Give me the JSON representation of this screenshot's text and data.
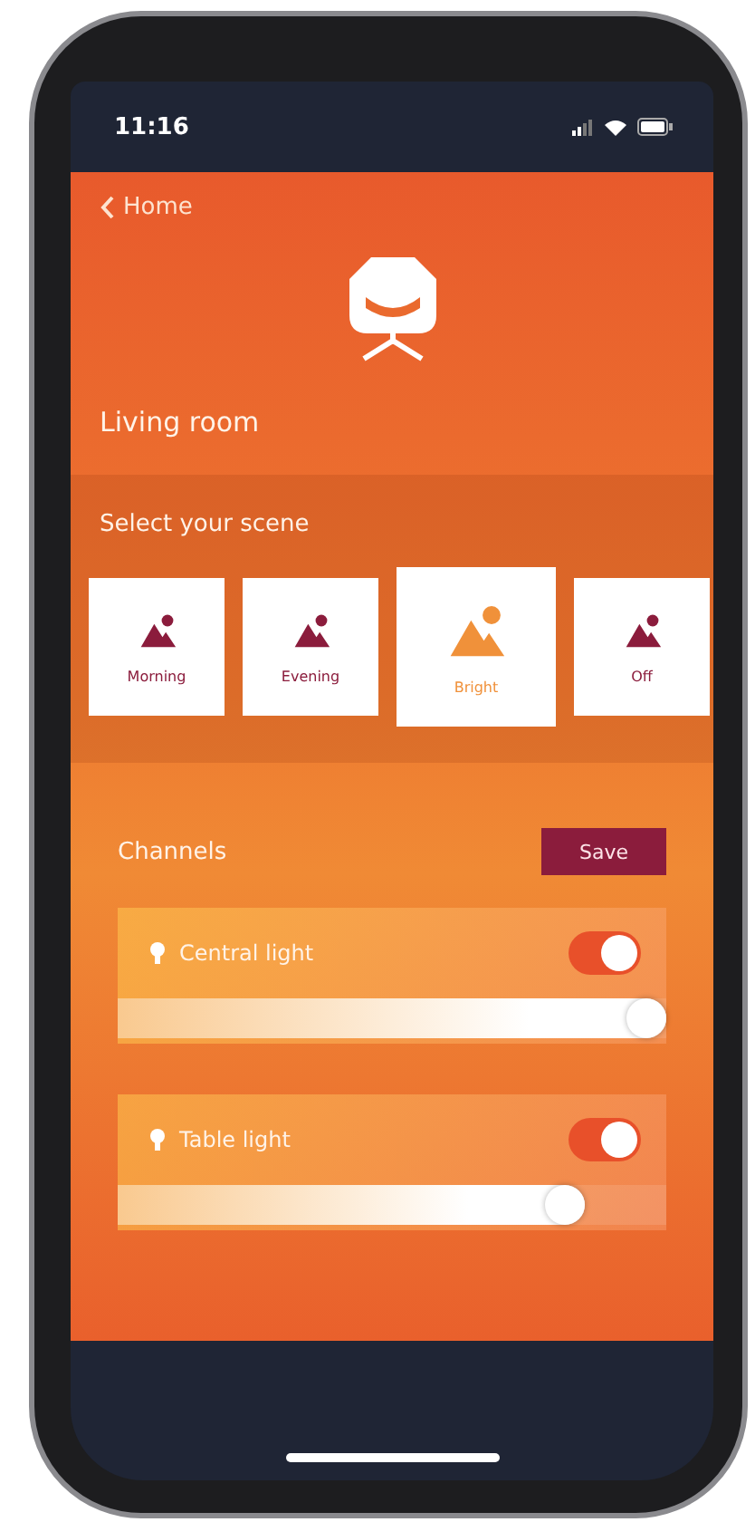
{
  "status_bar": {
    "time": "11:16"
  },
  "nav": {
    "back_label": "Home"
  },
  "room": {
    "title": "Living room"
  },
  "scenes": {
    "heading": "Select your scene",
    "items": [
      {
        "label": "Morning",
        "selected": false
      },
      {
        "label": "Evening",
        "selected": false
      },
      {
        "label": "Bright",
        "selected": true
      },
      {
        "label": "Off",
        "selected": false
      }
    ]
  },
  "channels": {
    "heading": "Channels",
    "save_button": "Save",
    "items": [
      {
        "name": "Central light",
        "on": true,
        "level": 1.0
      },
      {
        "name": "Table light",
        "on": true,
        "level": 0.85
      }
    ]
  }
}
